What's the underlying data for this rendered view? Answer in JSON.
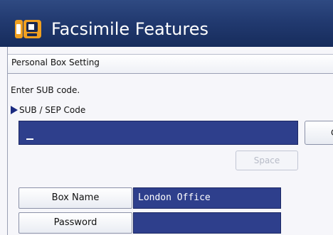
{
  "window": {
    "title": "Facsimile Features",
    "icon": "fax-features-icon"
  },
  "screen": {
    "header": "Personal Box Setting",
    "instruction": "Enter SUB code."
  },
  "sub_code": {
    "label": "SUB / SEP Code",
    "value": "",
    "clear_label": "C"
  },
  "space_button": {
    "label": "Space",
    "enabled": false
  },
  "rows": [
    {
      "label": "Box Name",
      "value": "London Office"
    },
    {
      "label": "Password",
      "value": ""
    }
  ],
  "colors": {
    "title_bar": "#223a70",
    "input_fill": "#2e3f8c",
    "arrow": "#1a2a80"
  }
}
